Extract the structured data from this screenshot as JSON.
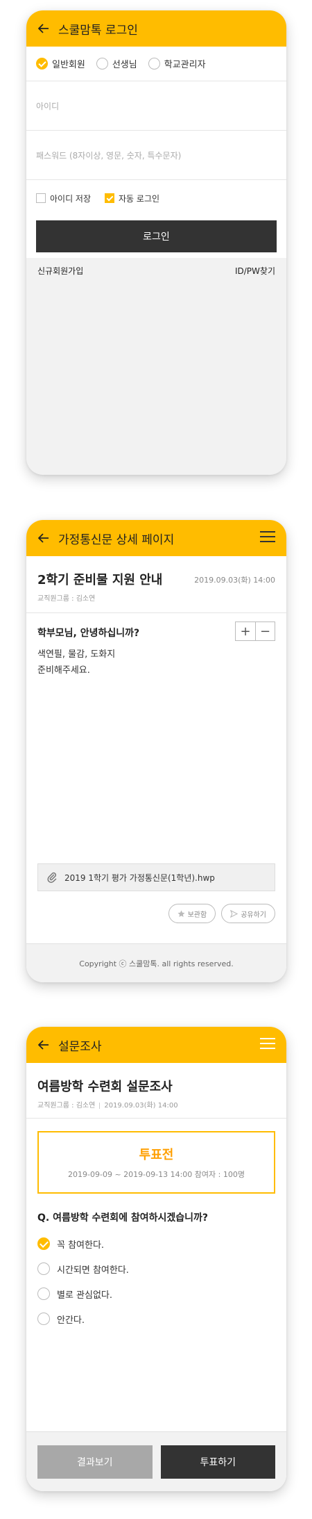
{
  "login": {
    "title": "스쿨맘톡 로그인",
    "user_types": [
      {
        "label": "일반회원",
        "selected": true
      },
      {
        "label": "선생님",
        "selected": false
      },
      {
        "label": "학교관리자",
        "selected": false
      }
    ],
    "id_placeholder": "아이디",
    "pw_placeholder": "패스워드 (8자이상, 영문, 숫자, 특수문자)",
    "save_id_label": "아이디 저장",
    "save_id_checked": false,
    "auto_login_label": "자동 로그인",
    "auto_login_checked": true,
    "login_button": "로그인",
    "signup_link": "신규회원가입",
    "find_link": "ID/PW찾기"
  },
  "notice": {
    "title": "가정통신문 상세 페이지",
    "post_title": "2학기 준비물 지원 안내",
    "date": "2019.09.03(화) 14:00",
    "author": "교직원그룹 : 김소연",
    "greeting": "학부모님, 안녕하십니까?",
    "content_lines": [
      "색연필, 물감, 도화지",
      "준비해주세요."
    ],
    "zoom_in": "+",
    "zoom_out": "−",
    "attachment": "2019 1학기 평가 가정통신문(1학년).hwp",
    "bookmark_label": "보관함",
    "share_label": "공유하기",
    "footer": "Copyright ⓒ 스쿨맘톡. all rights reserved."
  },
  "survey": {
    "title": "설문조사",
    "survey_title": "여름방학 수련회 설문조사",
    "author": "교직원그룹 : 김소연",
    "date": "2019.09.03(화) 14:00",
    "status": "투표전",
    "period": "2019-09-09 ~ 2019-09-13 14:00",
    "participants": "참여자 : 100명",
    "question": "Q. 여름방학 수련회에 참여하시겠습니까?",
    "options": [
      {
        "label": "꼭 참여한다.",
        "selected": true
      },
      {
        "label": "시간되면 참여한다.",
        "selected": false
      },
      {
        "label": "별로 관심없다.",
        "selected": false
      },
      {
        "label": "안간다.",
        "selected": false
      }
    ],
    "result_button": "결과보기",
    "vote_button": "투표하기"
  },
  "colors": {
    "accent": "#ffbc00",
    "status_text": "#ff9f00",
    "dark_button": "#333333",
    "disabled_button": "#a8a8a8"
  }
}
